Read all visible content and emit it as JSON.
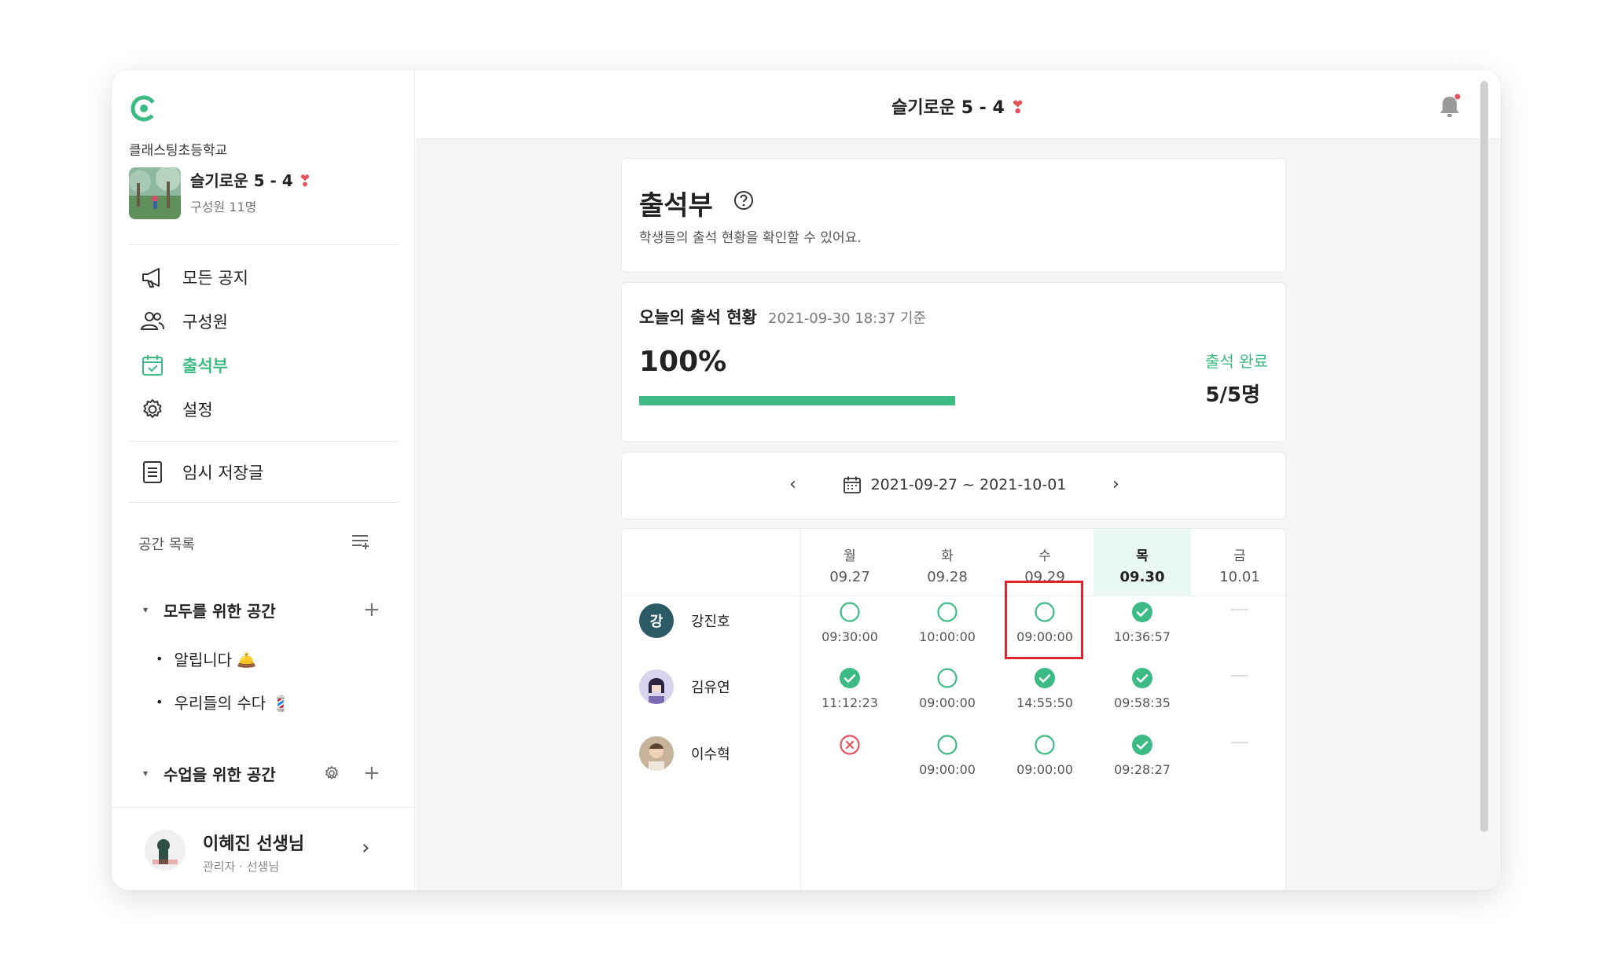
{
  "window_title": "슬기로운 5 - 4",
  "sidebar": {
    "school": "클래스팅초등학교",
    "class_title": "슬기로운 5 - 4",
    "class_members": "구성원 11명",
    "nav": [
      {
        "label": "모든 공지",
        "icon": "megaphone-icon"
      },
      {
        "label": "구성원",
        "icon": "members-icon"
      },
      {
        "label": "출석부",
        "icon": "calendar-check-icon",
        "active": true
      },
      {
        "label": "설정",
        "icon": "gear-icon"
      }
    ],
    "drafts": {
      "label": "임시 저장글",
      "icon": "document-icon"
    },
    "space_header": "공간 목록",
    "group_all": "모두를 위한 공간",
    "items_all": [
      "알립니다 🛎️",
      "우리들의 수다 💈"
    ],
    "group_class": "수업을 위한 공간",
    "user": {
      "name": "이혜진 선생님",
      "role": "관리자 · 선생님"
    }
  },
  "attendance": {
    "title": "출석부",
    "description": "학생들의 출석 현황을 확인할 수 있어요."
  },
  "today": {
    "title": "오늘의 출석 현황",
    "time": "2021-09-30 18:37 기준",
    "percent_label": "100%",
    "progress": 1.0,
    "done_label": "출석 완료",
    "done_count": "5/5명"
  },
  "week": {
    "prev": "‹",
    "next": "›",
    "range": "2021-09-27 ~ 2021-10-01"
  },
  "days": [
    {
      "day": "월",
      "date": "09.27"
    },
    {
      "day": "화",
      "date": "09.28"
    },
    {
      "day": "수",
      "date": "09.29"
    },
    {
      "day": "목",
      "date": "09.30",
      "today": true
    },
    {
      "day": "금",
      "date": "10.01"
    }
  ],
  "students": [
    {
      "name": "강진호",
      "initial": "강",
      "cells": [
        {
          "status": "open",
          "time": "09:30:00"
        },
        {
          "status": "open",
          "time": "10:00:00"
        },
        {
          "status": "open",
          "time": "09:00:00",
          "highlighted": true
        },
        {
          "status": "checked",
          "time": "10:36:57"
        },
        {
          "status": "none",
          "time": ""
        }
      ]
    },
    {
      "name": "김유연",
      "cells": [
        {
          "status": "checked",
          "time": "11:12:23"
        },
        {
          "status": "open",
          "time": "09:00:00"
        },
        {
          "status": "checked",
          "time": "14:55:50"
        },
        {
          "status": "checked",
          "time": "09:58:35"
        },
        {
          "status": "none",
          "time": ""
        }
      ]
    },
    {
      "name": "이수혁",
      "cells": [
        {
          "status": "absent",
          "time": ""
        },
        {
          "status": "open",
          "time": "09:00:00"
        },
        {
          "status": "open",
          "time": "09:00:00"
        },
        {
          "status": "checked",
          "time": "09:28:27"
        },
        {
          "status": "none",
          "time": ""
        }
      ]
    }
  ],
  "colors": {
    "accent": "#3dbb84",
    "absent": "#e5545d",
    "highlight": "#e0242d"
  }
}
